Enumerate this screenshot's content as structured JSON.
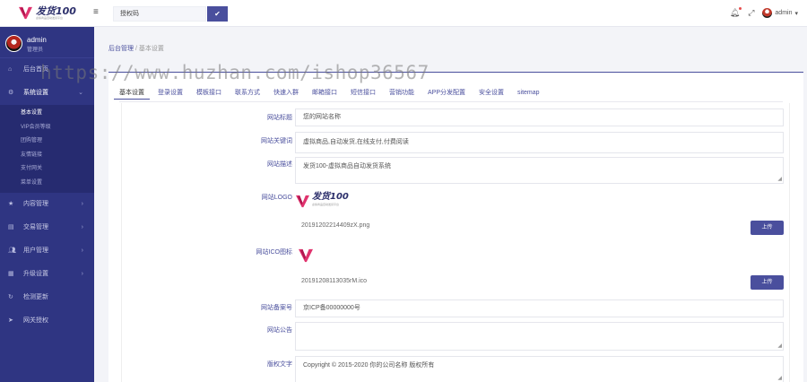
{
  "app": {
    "logo_text": "发货100",
    "logo_sub": "虚拟商品自动发货平台",
    "brand_color": "#2f3582",
    "accent_color": "#4a4f9d"
  },
  "topbar": {
    "search_value": "授权码",
    "search_icon": "check-icon",
    "user_name": "admin"
  },
  "profile": {
    "name": "admin",
    "role": "管理员"
  },
  "sidebar": {
    "items": [
      {
        "label": "后台首页",
        "icon": "home-icon"
      },
      {
        "label": "系统设置",
        "icon": "gear-icon",
        "expanded": true
      },
      {
        "label": "内容管理",
        "icon": "star-icon"
      },
      {
        "label": "交易管理",
        "icon": "card-icon"
      },
      {
        "label": "用户管理",
        "icon": "users-icon"
      },
      {
        "label": "升级设置",
        "icon": "upgrade-icon"
      },
      {
        "label": "检测更新",
        "icon": "refresh-icon"
      },
      {
        "label": "网关授权",
        "icon": "send-icon"
      }
    ],
    "sub_items": [
      "基本设置",
      "VIP会员等级",
      "团购管理",
      "友情链接",
      "支付网关",
      "菜单设置"
    ]
  },
  "breadcrumb": {
    "home": "后台管理",
    "separator": "/",
    "current": "基本设置"
  },
  "tabs": [
    "基本设置",
    "登录设置",
    "模板接口",
    "联系方式",
    "快速入群",
    "邮箱接口",
    "短信接口",
    "营销功能",
    "APP分发配置",
    "安全设置",
    "sitemap"
  ],
  "form": {
    "site_title": {
      "label": "网站标题",
      "value": "您的网站名称"
    },
    "keywords": {
      "label": "网站关键词",
      "value": "虚拟商品,自动发货,在线支付,付费阅读"
    },
    "description": {
      "label": "网站描述",
      "value": "发货100-虚拟商品自动发货系统"
    },
    "logo": {
      "label": "网站LOGO",
      "filename": "20191202214409zX.png",
      "upload_label": "上传"
    },
    "ico": {
      "label": "网站ICO图标",
      "filename": "20191208113035rM.ico",
      "upload_label": "上传"
    },
    "icp": {
      "label": "网站备案号",
      "value": "京ICP备00000000号"
    },
    "notice": {
      "label": "网站公告",
      "value": ""
    },
    "copyright": {
      "label": "版权文字",
      "value": "Copyright © 2015-2020 你的公司名称 版权所有"
    }
  },
  "watermark": "https://www.huzhan.com/ishop36567"
}
